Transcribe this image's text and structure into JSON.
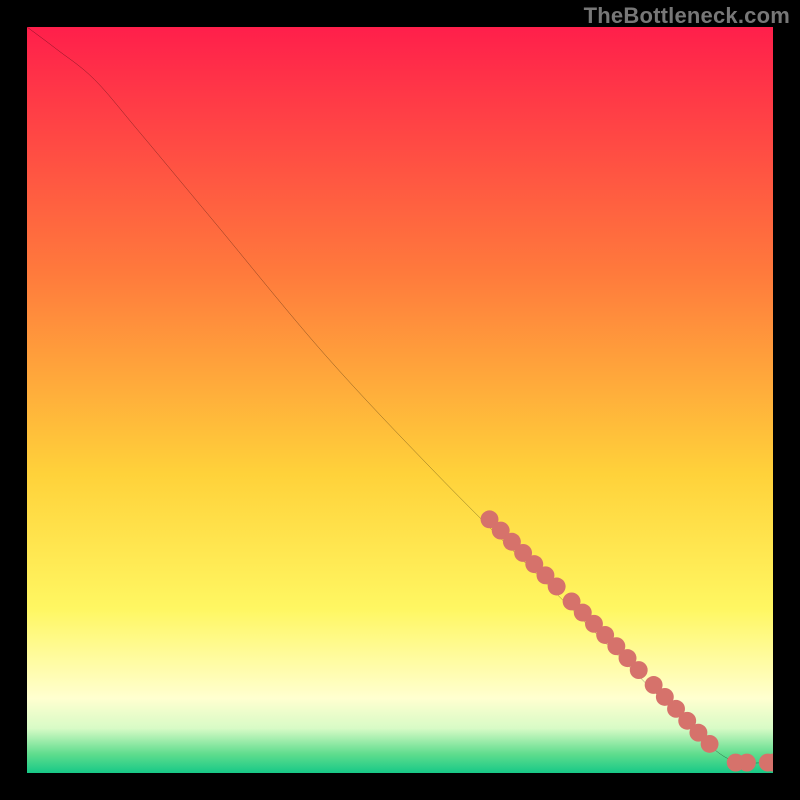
{
  "watermark": "TheBottleneck.com",
  "chart_data": {
    "type": "line",
    "title": "",
    "xlabel": "",
    "ylabel": "",
    "xlim": [
      0,
      100
    ],
    "ylim": [
      0,
      100
    ],
    "background_gradient_stops": [
      {
        "offset": 0,
        "color": "#ff1f4b"
      },
      {
        "offset": 0.33,
        "color": "#ff7a3c"
      },
      {
        "offset": 0.6,
        "color": "#ffd23a"
      },
      {
        "offset": 0.78,
        "color": "#fff762"
      },
      {
        "offset": 0.9,
        "color": "#ffffd0"
      },
      {
        "offset": 0.94,
        "color": "#d8fbc6"
      },
      {
        "offset": 0.975,
        "color": "#5edc8d"
      },
      {
        "offset": 1.0,
        "color": "#17c987"
      }
    ],
    "curve": {
      "points": [
        {
          "x": 0,
          "y": 100
        },
        {
          "x": 4,
          "y": 97
        },
        {
          "x": 9,
          "y": 93
        },
        {
          "x": 15,
          "y": 86
        },
        {
          "x": 25,
          "y": 74
        },
        {
          "x": 40,
          "y": 56
        },
        {
          "x": 55,
          "y": 40
        },
        {
          "x": 70,
          "y": 25
        },
        {
          "x": 80,
          "y": 15
        },
        {
          "x": 88,
          "y": 7
        },
        {
          "x": 93,
          "y": 2.5
        },
        {
          "x": 96,
          "y": 1.4
        },
        {
          "x": 99,
          "y": 1.4
        },
        {
          "x": 100,
          "y": 1.4
        }
      ]
    },
    "markers": {
      "color": "#d6726b",
      "radius": 1.2,
      "points": [
        {
          "x": 62,
          "y": 34
        },
        {
          "x": 63.5,
          "y": 32.5
        },
        {
          "x": 65,
          "y": 31
        },
        {
          "x": 66.5,
          "y": 29.5
        },
        {
          "x": 68,
          "y": 28
        },
        {
          "x": 69.5,
          "y": 26.5
        },
        {
          "x": 71,
          "y": 25
        },
        {
          "x": 73,
          "y": 23
        },
        {
          "x": 74.5,
          "y": 21.5
        },
        {
          "x": 76,
          "y": 20
        },
        {
          "x": 77.5,
          "y": 18.5
        },
        {
          "x": 79,
          "y": 17
        },
        {
          "x": 80.5,
          "y": 15.4
        },
        {
          "x": 82,
          "y": 13.8
        },
        {
          "x": 84,
          "y": 11.8
        },
        {
          "x": 85.5,
          "y": 10.2
        },
        {
          "x": 87,
          "y": 8.6
        },
        {
          "x": 88.5,
          "y": 7.0
        },
        {
          "x": 90,
          "y": 5.4
        },
        {
          "x": 91.5,
          "y": 3.9
        },
        {
          "x": 95,
          "y": 1.4
        },
        {
          "x": 96.5,
          "y": 1.4
        },
        {
          "x": 99.3,
          "y": 1.4
        },
        {
          "x": 100,
          "y": 1.4
        }
      ]
    }
  }
}
